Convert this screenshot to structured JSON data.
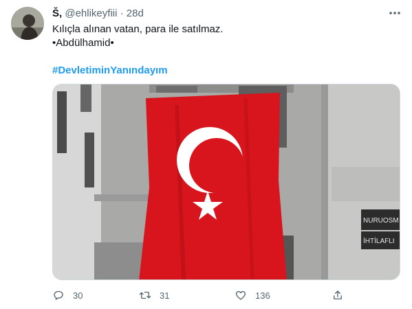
{
  "tweet": {
    "display_name": "Š,",
    "handle": "@ehlikeyfiii",
    "separator": "·",
    "time": "28d",
    "text_lines": [
      "Kılıçla alınan vatan, para ile satılmaz.",
      "•Abdülhamid•"
    ],
    "hashtag": "#DevletiminYanındayım",
    "media": {
      "description_icon": "turkish-flag-photo",
      "shop_sign_1": "NURUOSM",
      "shop_sign_2": "İHTİLAFLI"
    }
  },
  "actions": {
    "reply_count": "30",
    "retweet_count": "31",
    "like_count": "136"
  },
  "colors": {
    "accent": "#1d9bf0",
    "muted": "#536471",
    "flag_red": "#d8141c"
  }
}
